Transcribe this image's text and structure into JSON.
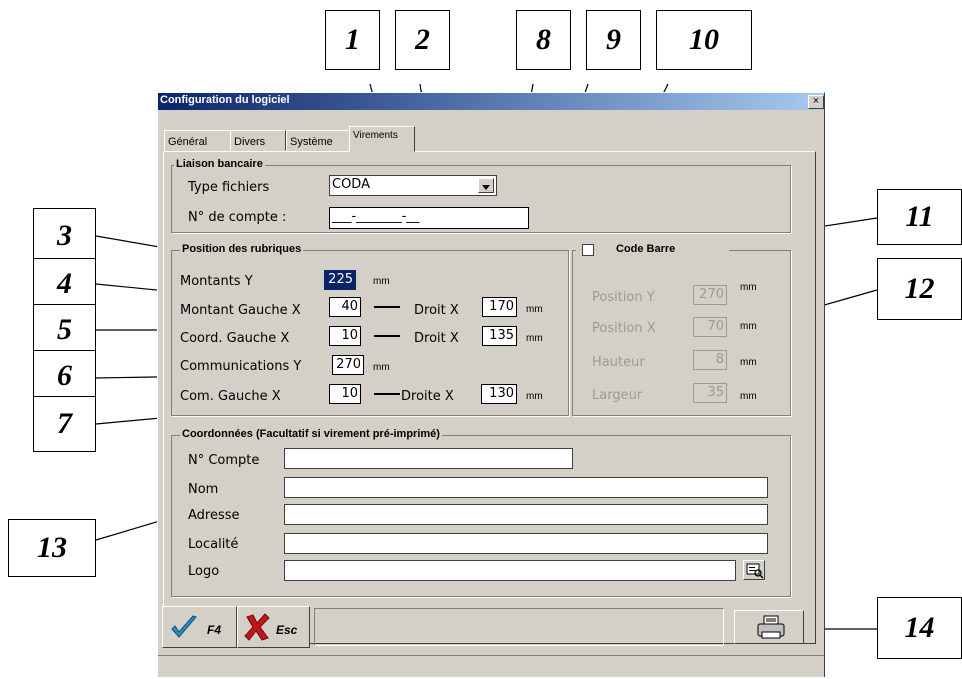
{
  "window": {
    "title": "Configuration du logiciel",
    "close_glyph": "×"
  },
  "tabs": [
    {
      "label": "Général",
      "active": false
    },
    {
      "label": "Divers",
      "active": false
    },
    {
      "label": "Système",
      "active": false
    },
    {
      "label": "Virements",
      "active": true
    }
  ],
  "liaison": {
    "legend": "Liaison bancaire",
    "type_label": "Type fichiers",
    "type_value": "CODA",
    "compte_label": "N° de compte :",
    "compte_value": "___-_______-__"
  },
  "position": {
    "legend": "Position des rubriques",
    "montants_label": "Montants  Y",
    "montants_value": "225",
    "montant_gauche_label": "Montant Gauche  X",
    "montant_gauche_value": "40",
    "droit_label": "Droit  X",
    "montant_droit_value": "170",
    "coord_gauche_label": "Coord. Gauche  X",
    "coord_gauche_value": "10",
    "coord_droit_value": "135",
    "communications_label": "Communications  Y",
    "communications_value": "270",
    "com_gauche_label": "Com. Gauche  X",
    "com_gauche_value": "10",
    "droite_label": "Droite  X",
    "com_droite_value": "130",
    "unit": "mm"
  },
  "codebarre": {
    "legend": "Code Barre",
    "checked": false,
    "position_y_label": "Position Y",
    "position_y_value": "270",
    "position_x_label": "Position X",
    "position_x_value": "70",
    "hauteur_label": "Hauteur",
    "hauteur_value": "8",
    "largeur_label": "Largeur",
    "largeur_value": "35",
    "unit": "mm"
  },
  "coordonnees": {
    "legend": "Coordonnées (Facultatif si virement pré-imprimé)",
    "compte_label": "N° Compte",
    "nom_label": "Nom",
    "adresse_label": "Adresse",
    "localite_label": "Localité",
    "logo_label": "Logo"
  },
  "footer": {
    "ok_label": "F4",
    "esc_label": "Esc"
  },
  "callouts": [
    "1",
    "2",
    "8",
    "9",
    "10",
    "3",
    "4",
    "5",
    "6",
    "7",
    "11",
    "12",
    "13",
    "14"
  ],
  "icons": [
    "close-icon",
    "dropdown-arrow-icon",
    "browse-icon",
    "checkmark-icon",
    "cross-icon",
    "printer-icon"
  ]
}
